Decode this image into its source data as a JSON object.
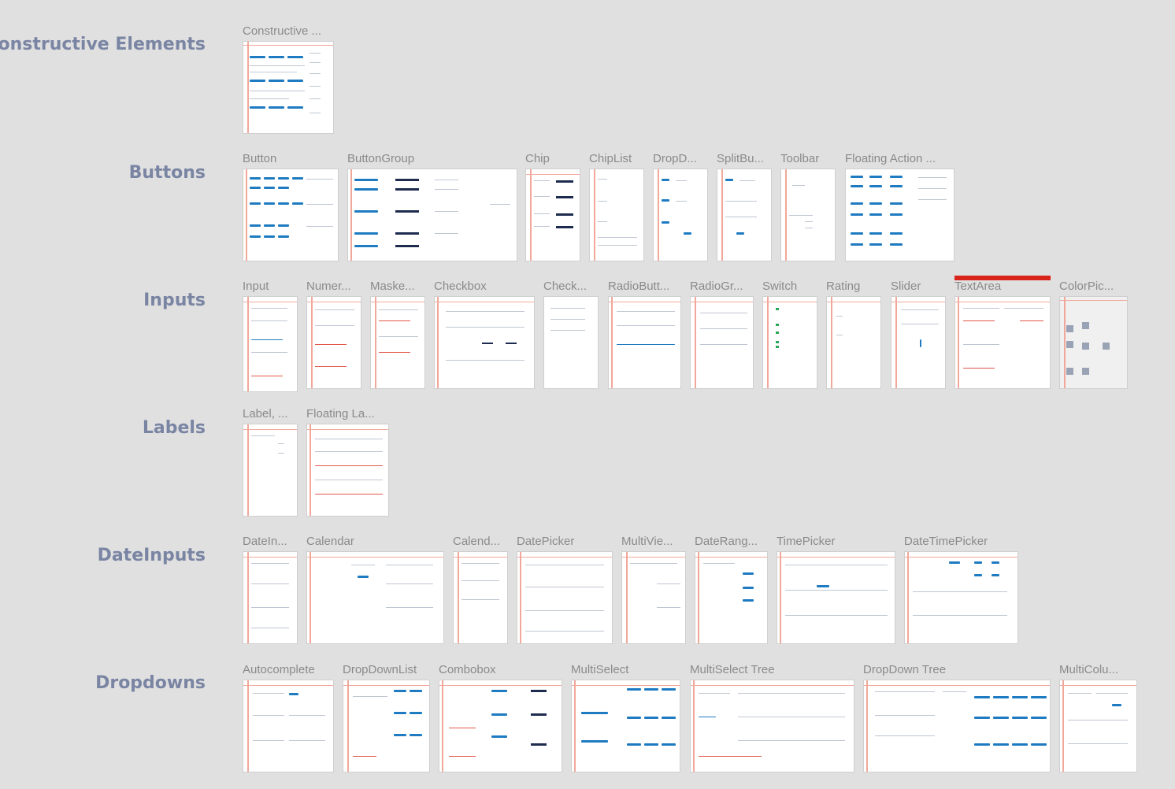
{
  "sections": [
    {
      "id": "constructive",
      "label": "Constructive Elements",
      "frames": [
        "Constructive ..."
      ]
    },
    {
      "id": "buttons",
      "label": "Buttons",
      "frames": [
        "Button",
        "ButtonGroup",
        "Chip",
        "ChipList",
        "DropD...",
        "SplitBu...",
        "Toolbar",
        "Floating Action ..."
      ]
    },
    {
      "id": "inputs",
      "label": "Inputs",
      "frames": [
        "Input",
        "Numer...",
        "Maske...",
        "Checkbox",
        "Check...",
        "RadioButt...",
        "RadioGr...",
        "Switch",
        "Rating",
        "Slider",
        "TextArea",
        "ColorPic..."
      ]
    },
    {
      "id": "labels",
      "label": "Labels",
      "frames": [
        "Label, ...",
        "Floating La..."
      ]
    },
    {
      "id": "dateinputs",
      "label": "DateInputs",
      "frames": [
        "DateIn...",
        "Calendar",
        "Calend...",
        "DatePicker",
        "MultiVie...",
        "DateRang...",
        "TimePicker",
        "DateTimePicker"
      ]
    },
    {
      "id": "dropdowns",
      "label": "Dropdowns",
      "frames": [
        "Autocomplete",
        "DropDownList",
        "Combobox",
        "MultiSelect",
        "MultiSelect Tree",
        "DropDown Tree",
        "MultiColu..."
      ]
    }
  ],
  "selected_frame": "TextArea",
  "colors": {
    "background": "#e0e0e0",
    "section_label": "#7a85a3",
    "frame_title": "#8a8a8a",
    "redline": "#f1a89a",
    "accent_blue": "#1f7bc1",
    "selection": "#d9241c"
  }
}
